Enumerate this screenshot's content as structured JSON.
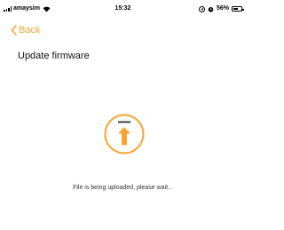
{
  "status_bar": {
    "carrier": "amaysim",
    "time": "15:32",
    "battery_percent": "56%",
    "icons": [
      "signal-icon",
      "wifi-icon",
      "location-icon",
      "alarm-icon",
      "battery-icon"
    ]
  },
  "nav": {
    "back_label": "Back",
    "back_icon": "chevron-left-icon"
  },
  "page": {
    "title": "Update firmware",
    "status_message": "File is being uploaded, please wait..."
  },
  "upload_indicator": {
    "icon": "upload-arrow-icon",
    "color": "#f7a533"
  },
  "colors": {
    "accent": "#f7a533",
    "background": "#ffffff",
    "text": "#111111"
  }
}
